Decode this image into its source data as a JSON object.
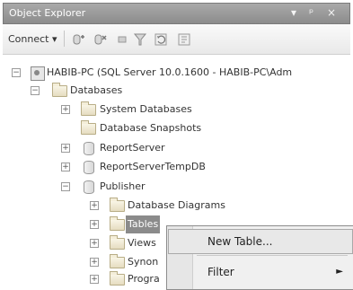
{
  "window": {
    "title": "Object Explorer",
    "controls": [
      "▾",
      "ᵖ",
      "×"
    ]
  },
  "toolbar": {
    "connect_label": "Connect ▾",
    "icons": [
      "connect-db-icon",
      "disconnect-icon",
      "stop-icon",
      "filter-icon",
      "refresh-icon",
      "summary-icon"
    ]
  },
  "tree": {
    "server": "HABIB-PC (SQL Server 10.0.1600 - HABIB-PC\\Adm",
    "databases": "Databases",
    "system_databases": "System Databases",
    "database_snapshots": "Database Snapshots",
    "reportserver": "ReportServer",
    "reportservertempdb": "ReportServerTempDB",
    "publisher": "Publisher",
    "database_diagrams": "Database Diagrams",
    "tables": "Tables",
    "views": "Views",
    "synonyms": "Synon",
    "programmability": "Progra"
  },
  "context_menu": {
    "items": [
      "New Table...",
      "Filter"
    ],
    "hovered_item": "New Table..."
  },
  "colors": {
    "titlebar": "#8c8c8c",
    "selection": "#8b8b8b",
    "menu_hover_border": "#a9a9a9"
  }
}
